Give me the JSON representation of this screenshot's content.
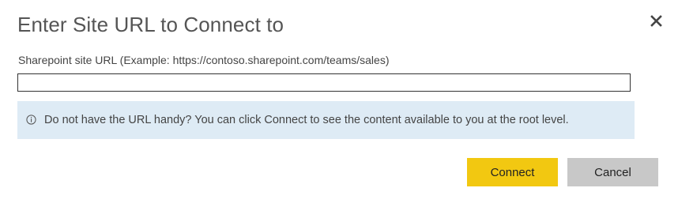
{
  "dialog": {
    "title": "Enter Site URL to Connect to",
    "close_icon": "close-icon",
    "field": {
      "label": "Sharepoint site URL (Example: https://contoso.sharepoint.com/teams/sales)",
      "value": "",
      "placeholder": ""
    },
    "info": {
      "icon": "info-icon",
      "text": "Do not have the URL handy? You can click Connect to see the content available to you at the root level."
    },
    "buttons": {
      "connect_label": "Connect",
      "cancel_label": "Cancel"
    },
    "colors": {
      "accent": "#f2c811",
      "info_background": "#deebf5",
      "cancel_background": "#c8c8c8"
    }
  }
}
